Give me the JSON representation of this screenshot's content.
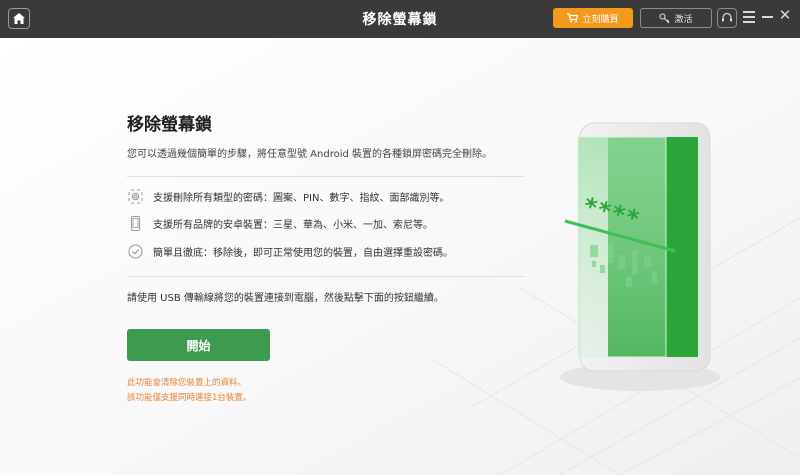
{
  "titlebar": {
    "title": "移除螢幕鎖",
    "buy_label": "立刻購買",
    "activate_label": "激活"
  },
  "main": {
    "title": "移除螢幕鎖",
    "subtitle": "您可以透過幾個簡單的步驟，將任意型號 Android 裝置的各種鎖屏密碼完全刪除。",
    "features": [
      "支援刪除所有類型的密碼：圖案、PIN、數字、指紋、面部識別等。",
      "支援所有品牌的安卓裝置：三星、華為、小米、一加、索尼等。",
      "簡單且徹底：移除後，即可正常使用您的裝置，自由選擇重設密碼。"
    ],
    "instruction": "請使用 USB 傳輸線將您的裝置連接到電腦，然後點擊下面的按鈕繼續。",
    "start_label": "開始",
    "warnings": [
      "此功能會清除您裝置上的資料。",
      "該功能僅支援同時連接1台裝置。"
    ]
  },
  "illustration": {
    "password_mask": "****"
  },
  "colors": {
    "accent_green": "#3d9a4f",
    "buy_orange": "#f39a1d",
    "warning_orange": "#e8833a",
    "titlebar_bg": "#3a3a3a"
  },
  "icons": [
    "home-icon",
    "cart-icon",
    "key-icon",
    "headset-icon",
    "menu-icon",
    "minimize-icon",
    "close-icon",
    "fingerprint-icon",
    "phone-icon",
    "check-circle-icon"
  ]
}
